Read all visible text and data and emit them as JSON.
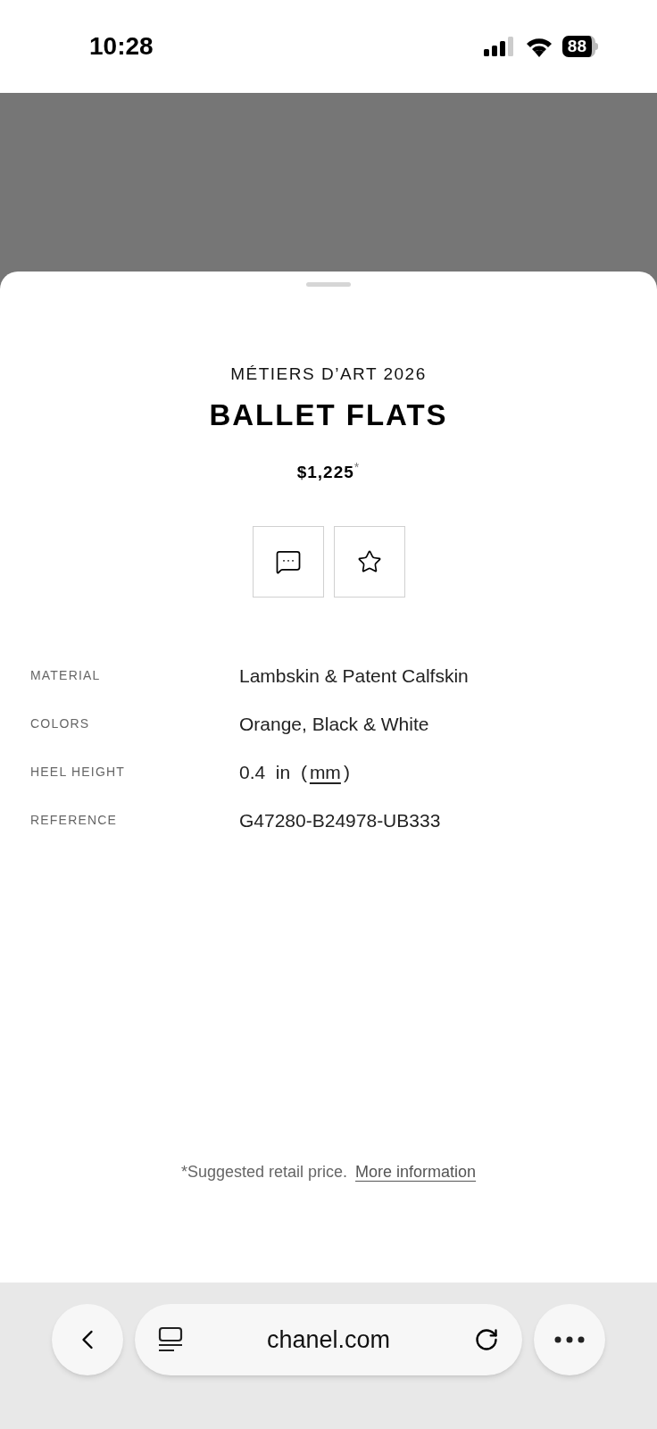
{
  "status_bar": {
    "time": "10:28",
    "battery": "88"
  },
  "product": {
    "collection": "MÉTIERS D’ART 2026",
    "title": "BALLET FLATS",
    "price": "$1,225$^{*}$"
  },
  "specs": [
    {
      "label": "MATERIAL",
      "value": "Lambskin & Patent Calfskin"
    },
    {
      "label": "COLORS",
      "value": "Orange, Black & White"
    },
    {
      "label": "HEEL HEIGHT",
      "value": "0.4  in  (",
      "link": "mm",
      "suffix": ")"
    },
    {
      "label": "REFERENCE",
      "value": "G47280-B24978-UB333"
    }
  ],
  "footnote": {
    "text": "*Suggested retail price.",
    "link": "More information"
  },
  "browser_bar": {
    "url": "chanel.com"
  }
}
